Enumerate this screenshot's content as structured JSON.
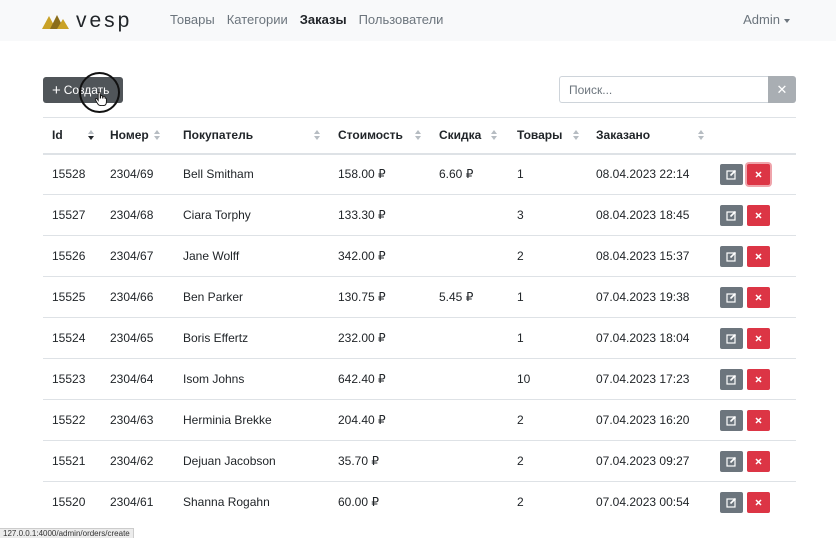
{
  "brand": {
    "name": "vesp"
  },
  "nav": {
    "items": [
      {
        "label": "Товары",
        "active": false
      },
      {
        "label": "Категории",
        "active": false
      },
      {
        "label": "Заказы",
        "active": true
      },
      {
        "label": "Пользователи",
        "active": false
      }
    ],
    "user": "Admin"
  },
  "toolbar": {
    "create_label": "Создать",
    "search_placeholder": "Поиск..."
  },
  "table": {
    "columns": [
      {
        "label": "Id",
        "sortable": true,
        "sort": "desc"
      },
      {
        "label": "Номер",
        "sortable": true
      },
      {
        "label": "Покупатель",
        "sortable": true
      },
      {
        "label": "Стоимость",
        "sortable": true
      },
      {
        "label": "Скидка",
        "sortable": true
      },
      {
        "label": "Товары",
        "sortable": true
      },
      {
        "label": "Заказано",
        "sortable": true
      }
    ],
    "rows": [
      {
        "id": "15528",
        "num": "2304/69",
        "customer": "Bell Smitham",
        "cost": "158.00 ₽",
        "discount": "6.60 ₽",
        "items": "1",
        "ordered": "08.04.2023 22:14"
      },
      {
        "id": "15527",
        "num": "2304/68",
        "customer": "Ciara Torphy",
        "cost": "133.30 ₽",
        "discount": "",
        "items": "3",
        "ordered": "08.04.2023 18:45"
      },
      {
        "id": "15526",
        "num": "2304/67",
        "customer": "Jane Wolff",
        "cost": "342.00 ₽",
        "discount": "",
        "items": "2",
        "ordered": "08.04.2023 15:37"
      },
      {
        "id": "15525",
        "num": "2304/66",
        "customer": "Ben Parker",
        "cost": "130.75 ₽",
        "discount": "5.45 ₽",
        "items": "1",
        "ordered": "07.04.2023 19:38"
      },
      {
        "id": "15524",
        "num": "2304/65",
        "customer": "Boris Effertz",
        "cost": "232.00 ₽",
        "discount": "",
        "items": "1",
        "ordered": "07.04.2023 18:04"
      },
      {
        "id": "15523",
        "num": "2304/64",
        "customer": "Isom Johns",
        "cost": "642.40 ₽",
        "discount": "",
        "items": "10",
        "ordered": "07.04.2023 17:23"
      },
      {
        "id": "15522",
        "num": "2304/63",
        "customer": "Herminia Brekke",
        "cost": "204.40 ₽",
        "discount": "",
        "items": "2",
        "ordered": "07.04.2023 16:20"
      },
      {
        "id": "15521",
        "num": "2304/62",
        "customer": "Dejuan Jacobson",
        "cost": "35.70 ₽",
        "discount": "",
        "items": "2",
        "ordered": "07.04.2023 09:27"
      },
      {
        "id": "15520",
        "num": "2304/61",
        "customer": "Shanna Rogahn",
        "cost": "60.00 ₽",
        "discount": "",
        "items": "2",
        "ordered": "07.04.2023 00:54"
      }
    ],
    "row_actions": {
      "edit_icon": "edit-icon",
      "delete_icon": "close-icon"
    }
  },
  "status_bar": {
    "url": "127.0.0.1:4000/admin/orders/create"
  },
  "colors": {
    "brand_gold": "#c9a227",
    "delete": "#dc3545",
    "edit": "#6c757d",
    "create": "#505559"
  }
}
